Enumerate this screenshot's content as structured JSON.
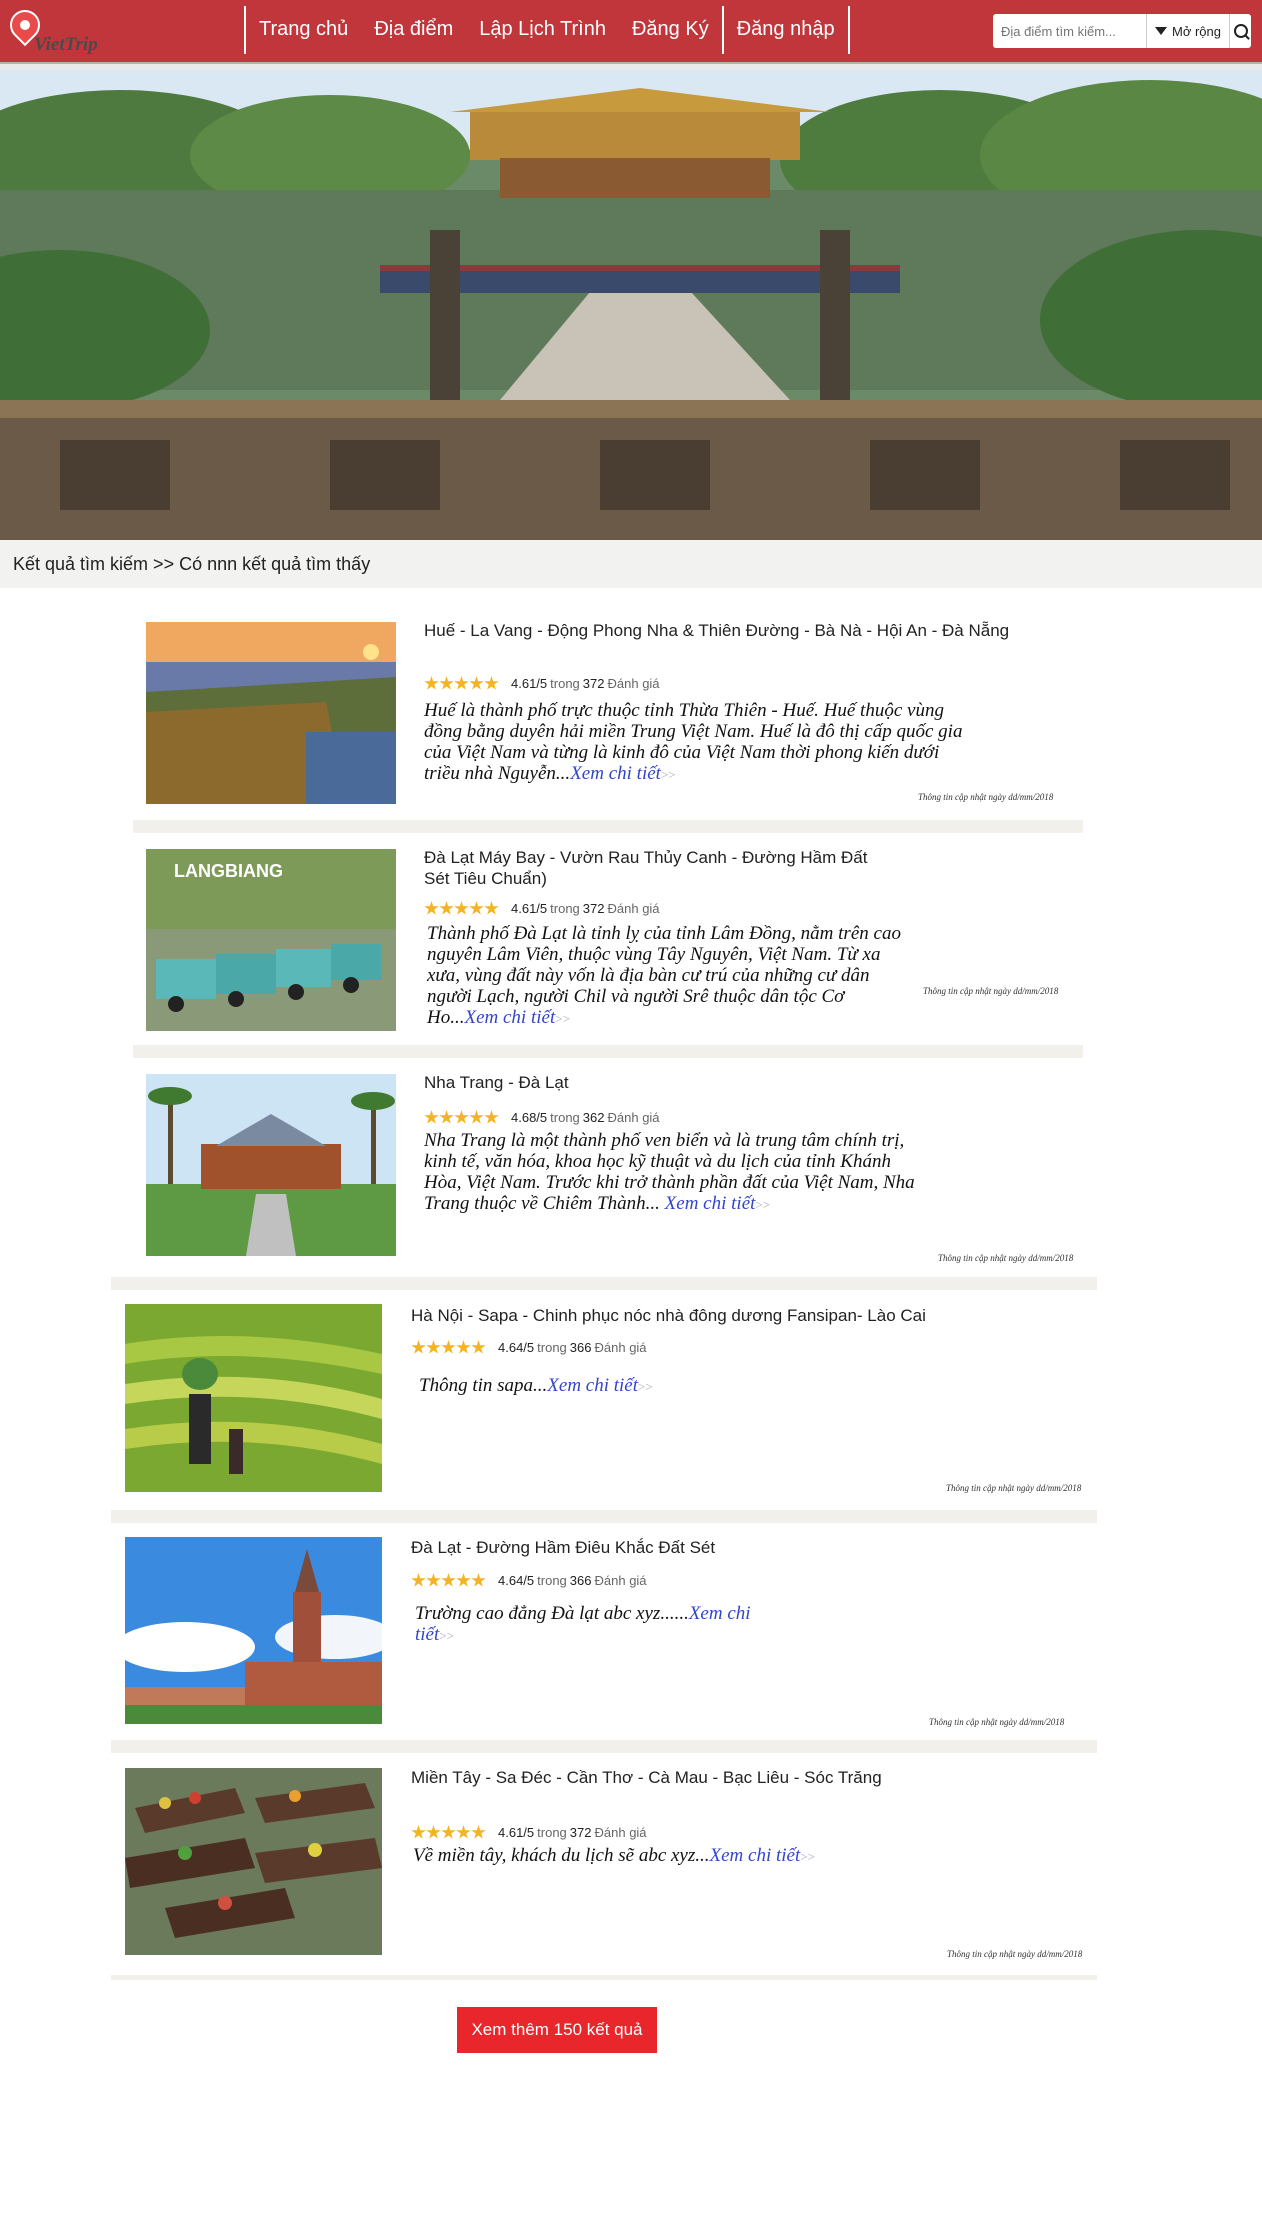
{
  "brand": {
    "name": "VietTrip"
  },
  "nav": {
    "items": [
      "Trang chủ",
      "Địa điểm",
      "Lập Lịch Trình",
      "Đăng Ký",
      "Đăng nhập"
    ]
  },
  "search": {
    "placeholder": "Địa điểm tìm kiếm...",
    "value": "",
    "filter_label": "Mở rộng",
    "filter_icon": "filter-icon",
    "search_icon": "search-icon"
  },
  "hero": {
    "description": "Hue imperial city banner"
  },
  "breadcrumb": {
    "text": "Kết quả tìm kiếm >> Có nnn kết quả tìm thấy"
  },
  "results": [
    {
      "title": "Huế - La Vang - Động Phong Nha & Thiên Đường - Bà Nà - Hội An - Đà Nẵng",
      "rating": "4.61/5",
      "trong": "trong",
      "reviews": "372",
      "review_label": "Đánh giá",
      "description": "Huế là thành phố trực thuộc tỉnh Thừa Thiên - Huế. Huế thuộc vùng đồng bằng duyên hải miền Trung Việt Nam. Huế là đô thị cấp quốc gia của Việt Nam và từng là kinh đô của Việt Nam thời phong kiến dưới triều nhà Nguyễn...",
      "more": "Xem chi tiết",
      "arrow": ">>",
      "updated": "Thông tin cập nhật ngày dd/mm/2018"
    },
    {
      "title": "Đà Lạt Máy Bay - Vườn Rau Thủy Canh - Đường Hầm Đất Sét Tiêu Chuẩn)",
      "rating": "4.61/5",
      "trong": "trong",
      "reviews": "372",
      "review_label": "Đánh giá",
      "description": "Thành phố Đà Lạt là tỉnh lỵ của tỉnh Lâm Đồng, nằm trên cao nguyên Lâm Viên, thuộc vùng Tây Nguyên, Việt Nam. Từ xa xưa, vùng đất này vốn là địa bàn cư trú của những cư dân người Lạch, người Chil và người Srê thuộc dân tộc Cơ Ho...",
      "more": "Xem chi tiết",
      "arrow": ">>",
      "updated": "Thông tin cập nhật ngày dd/mm/2018",
      "thumb_text": "LANGBIANG"
    },
    {
      "title": "Nha Trang - Đà Lạt",
      "rating": "4.68/5",
      "trong": "trong",
      "reviews": "362",
      "review_label": "Đánh giá",
      "description": "Nha Trang là một thành phố ven biển và là trung tâm chính trị, kinh tế, văn hóa, khoa học kỹ thuật và du lịch của tỉnh Khánh Hòa, Việt Nam. Trước khi trở thành phần đất của Việt Nam, Nha Trang thuộc về Chiêm Thành... ",
      "more": "Xem chi tiết",
      "arrow": ">>",
      "updated": "Thông tin cập nhật ngày dd/mm/2018"
    },
    {
      "title": "Hà Nội - Sapa - Chinh phục nóc nhà đông dương Fansipan- Lào Cai",
      "rating": "4.64/5",
      "trong": "trong",
      "reviews": "366",
      "review_label": "Đánh giá",
      "description": "Thông tin sapa...",
      "more": "Xem chi tiết",
      "arrow": ">>",
      "updated": "Thông tin cập nhật ngày dd/mm/2018"
    },
    {
      "title": "Đà Lạt - Đường Hầm Điêu Khắc Đất Sét",
      "rating": "4.64/5",
      "trong": "trong",
      "reviews": "366",
      "review_label": "Đánh giá",
      "description": "Trường cao đẳng Đà lạt abc xyz......",
      "more": "Xem chi tiết",
      "arrow": ">>",
      "updated": "Thông tin cập nhật ngày dd/mm/2018"
    },
    {
      "title": "Miền Tây - Sa Đéc - Cần Thơ - Cà Mau - Bạc Liêu - Sóc Trăng",
      "rating": "4.61/5",
      "trong": "trong",
      "reviews": "372",
      "review_label": "Đánh giá",
      "description": "Về miền tây, khách du lịch sẽ abc xyz...",
      "more": "Xem chi tiết",
      "arrow": ">>",
      "updated": "Thông tin cập nhật ngày dd/mm/2018"
    }
  ],
  "load_more": {
    "label": "Xem thêm 150 kết quả"
  },
  "colors": {
    "navbar": "#c0363b",
    "accent_button": "#e8262b",
    "link": "#3344cc",
    "star": "#f4b323"
  }
}
